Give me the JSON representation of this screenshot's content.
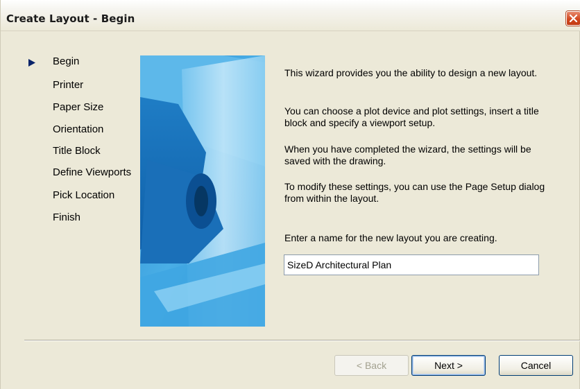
{
  "window": {
    "title": "Create Layout - Begin"
  },
  "steps": [
    {
      "label": "Begin",
      "current": true
    },
    {
      "label": "Printer",
      "current": false
    },
    {
      "label": "Paper Size",
      "current": false
    },
    {
      "label": "Orientation",
      "current": false
    },
    {
      "label": "Title Block",
      "current": false
    },
    {
      "label": "Define Viewports",
      "current": false
    },
    {
      "label": "Pick Location",
      "current": false
    },
    {
      "label": "Finish",
      "current": false
    }
  ],
  "description": {
    "p1": "This wizard provides you the ability to design a new layout.",
    "p2": "You can choose a plot device and plot settings, insert a title block and specify a viewport setup.",
    "p3": "When you have completed the wizard, the settings will be saved with the drawing.",
    "p4": "To modify these settings, you can use the Page Setup dialog from within the layout."
  },
  "name_prompt": "Enter a name for the new layout you are creating.",
  "name_input": {
    "value": "SizeD Architectural Plan"
  },
  "buttons": {
    "back": "< Back",
    "next": "Next >",
    "cancel": "Cancel"
  },
  "icons": {
    "current_step": "arrow-right-icon",
    "close": "close-icon"
  },
  "colors": {
    "banner": "#3a9bd8",
    "arrow": "#0a246a",
    "close": "#d2471f"
  }
}
